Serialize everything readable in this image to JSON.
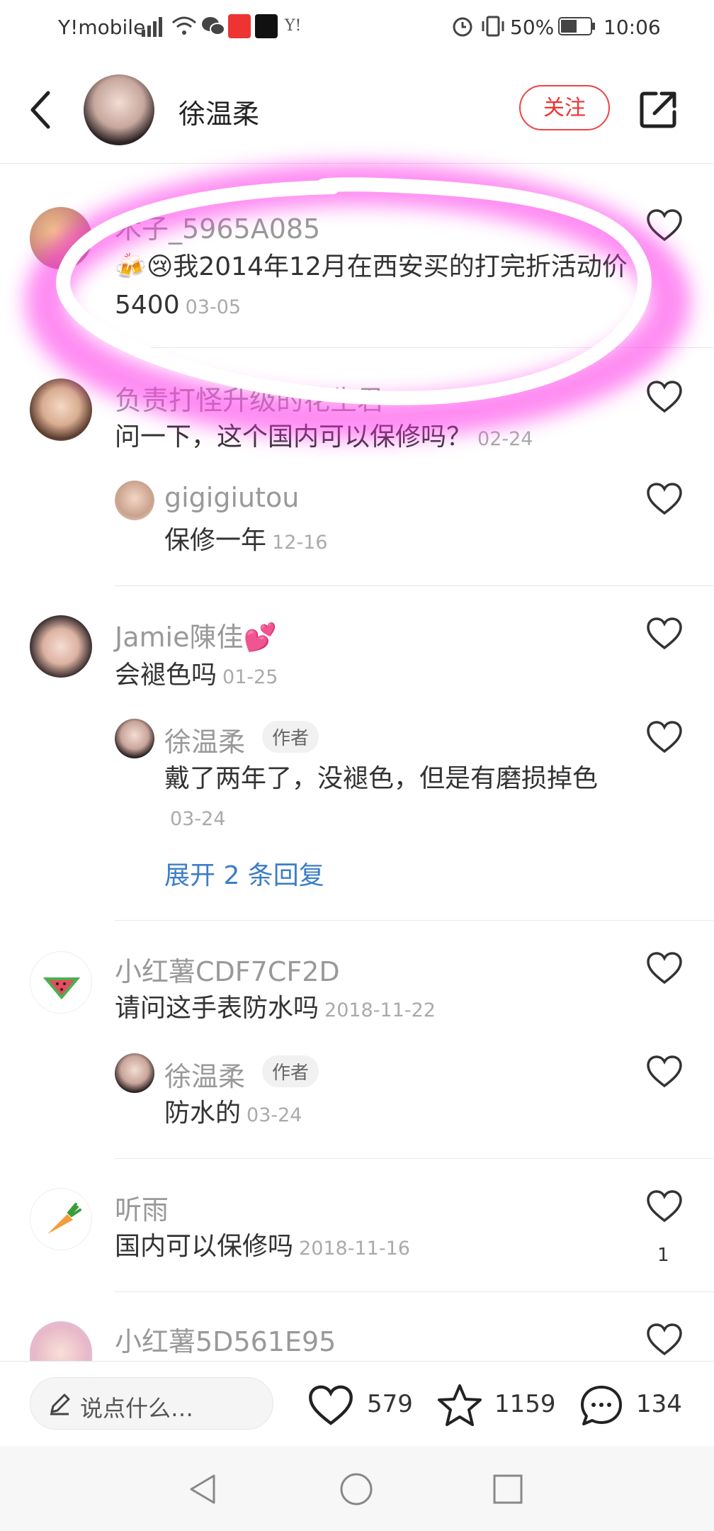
{
  "status_bar": {
    "carrier": "Y!mobile",
    "battery": "50%",
    "time": "10:06"
  },
  "header": {
    "author_name": "徐温柔",
    "follow_label": "关注"
  },
  "comments": [
    {
      "user": "木子_5965A085",
      "text": "🍻😢我2014年12月在西安买的打完折活动价5400",
      "time": "03-05"
    },
    {
      "user": "负责打怪升级的花生君",
      "text": "问一下，这个国内可以保修吗？",
      "time": "02-24",
      "reply": {
        "user": "gigigiutou",
        "text": "保修一年",
        "time": "12-16"
      }
    },
    {
      "user": "Jamie陳佳💕",
      "text": "会褪色吗",
      "time": "01-25",
      "reply": {
        "user": "徐温柔",
        "badge": "作者",
        "text": "戴了两年了，没褪色，但是有磨损掉色",
        "time": "03-24"
      },
      "expand": "展开 2 条回复"
    },
    {
      "user": "小红薯CDF7CF2D",
      "text": "请问这手表防水吗",
      "time": "2018-11-22",
      "reply": {
        "user": "徐温柔",
        "badge": "作者",
        "text": "防水的",
        "time": "03-24"
      }
    },
    {
      "user": "听雨",
      "text": "国内可以保修吗",
      "time": "2018-11-16",
      "likes": "1"
    },
    {
      "user": "小红薯5D561E95"
    }
  ],
  "bottom_bar": {
    "input_placeholder": "说点什么…",
    "likes": "579",
    "favorites": "1159",
    "comments": "134"
  }
}
